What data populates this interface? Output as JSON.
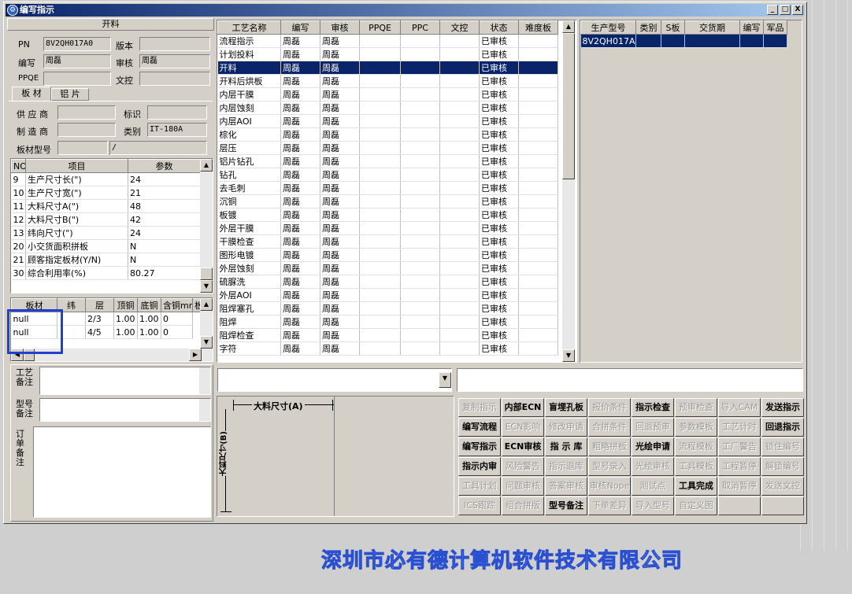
{
  "window": {
    "title": "编写指示",
    "min": "_",
    "max": "□",
    "close": "X"
  },
  "cut": {
    "header": "开料",
    "pn_label": "PN",
    "pn": "8V2QH017A0",
    "version_label": "版本",
    "version": "",
    "writer_label": "编写",
    "writer": "周磊",
    "audit_label": "审核",
    "audit": "周磊",
    "ppqe_label": "PPQE",
    "ppqe": "",
    "control_label": "文控",
    "control": ""
  },
  "tabs": [
    "板 材",
    "铝 片"
  ],
  "board": {
    "supplier_label": "供 应 商",
    "supplier": "",
    "mark_label": "标识",
    "mark": "",
    "maker_label": "制 造 商",
    "maker": "",
    "category_label": "类别",
    "category": "IT-180A",
    "model_label": "板材型号",
    "model": "",
    "model2": "/"
  },
  "params": {
    "headers": [
      "NO",
      "项目",
      "参数"
    ],
    "rows": [
      [
        "9",
        "生产尺寸长(\")",
        "24"
      ],
      [
        "10",
        "生产尺寸宽(\")",
        "21"
      ],
      [
        "11",
        "大料尺寸A(\")",
        "48"
      ],
      [
        "12",
        "大料尺寸B(\")",
        "42"
      ],
      [
        "13",
        "纬向尺寸(\")",
        "24"
      ],
      [
        "20",
        "小交货面积拼板",
        "N"
      ],
      [
        "21",
        "顾客指定板材(Y/N)",
        "N"
      ],
      [
        "30",
        "综合利用率(%)",
        "80.27"
      ]
    ]
  },
  "mat": {
    "headers": [
      "板材",
      "纬",
      "层",
      "顶铜",
      "底铜",
      "含铜mm",
      "板"
    ],
    "rows": [
      [
        "null",
        "",
        "2/3",
        "1.00",
        "1.00",
        "0"
      ],
      [
        "null",
        "",
        "4/5",
        "1.00",
        "1.00",
        "0"
      ]
    ]
  },
  "notes": {
    "process_label": "工艺备注",
    "type_label": "型号备注",
    "order_label": "订单备注"
  },
  "process": {
    "headers": [
      "工艺名称",
      "编写",
      "审核",
      "PPQE",
      "PPC",
      "文控",
      "状态",
      "难度板"
    ],
    "rows": [
      [
        "流程指示",
        "周磊",
        "周磊",
        "",
        "",
        "",
        "已审核",
        ""
      ],
      [
        "计划投料",
        "周磊",
        "周磊",
        "",
        "",
        "",
        "已审核",
        ""
      ],
      [
        "开料",
        "周磊",
        "周磊",
        "",
        "",
        "",
        "已审核",
        ""
      ],
      [
        "开料后烘板",
        "周磊",
        "周磊",
        "",
        "",
        "",
        "已审核",
        ""
      ],
      [
        "内层干膜",
        "周磊",
        "周磊",
        "",
        "",
        "",
        "已审核",
        ""
      ],
      [
        "内层蚀刻",
        "周磊",
        "周磊",
        "",
        "",
        "",
        "已审核",
        ""
      ],
      [
        "内层AOI",
        "周磊",
        "周磊",
        "",
        "",
        "",
        "已审核",
        ""
      ],
      [
        "棕化",
        "周磊",
        "周磊",
        "",
        "",
        "",
        "已审核",
        ""
      ],
      [
        "层压",
        "周磊",
        "周磊",
        "",
        "",
        "",
        "已审核",
        ""
      ],
      [
        "铝片钻孔",
        "周磊",
        "周磊",
        "",
        "",
        "",
        "已审核",
        ""
      ],
      [
        "钻孔",
        "周磊",
        "周磊",
        "",
        "",
        "",
        "已审核",
        ""
      ],
      [
        "去毛刺",
        "周磊",
        "周磊",
        "",
        "",
        "",
        "已审核",
        ""
      ],
      [
        "沉铜",
        "周磊",
        "周磊",
        "",
        "",
        "",
        "已审核",
        ""
      ],
      [
        "板镀",
        "周磊",
        "周磊",
        "",
        "",
        "",
        "已审核",
        ""
      ],
      [
        "外层干膜",
        "周磊",
        "周磊",
        "",
        "",
        "",
        "已审核",
        ""
      ],
      [
        "干膜检查",
        "周磊",
        "周磊",
        "",
        "",
        "",
        "已审核",
        ""
      ],
      [
        "图形电镀",
        "周磊",
        "周磊",
        "",
        "",
        "",
        "已审核",
        ""
      ],
      [
        "外层蚀刻",
        "周磊",
        "周磊",
        "",
        "",
        "",
        "已审核",
        ""
      ],
      [
        "硫脲洗",
        "周磊",
        "周磊",
        "",
        "",
        "",
        "已审核",
        ""
      ],
      [
        "外层AOI",
        "周磊",
        "周磊",
        "",
        "",
        "",
        "已审核",
        ""
      ],
      [
        "阻焊塞孔",
        "周磊",
        "周磊",
        "",
        "",
        "",
        "已审核",
        ""
      ],
      [
        "阻焊",
        "周磊",
        "周磊",
        "",
        "",
        "",
        "已审核",
        ""
      ],
      [
        "阻焊检查",
        "周磊",
        "周磊",
        "",
        "",
        "",
        "已审核",
        ""
      ],
      [
        "字符",
        "周磊",
        "周磊",
        "",
        "",
        "",
        "已审核",
        ""
      ]
    ],
    "selected": 2
  },
  "models": {
    "headers": [
      "生产型号",
      "类别",
      "S板",
      "交货期",
      "编写",
      "军品"
    ],
    "rows": [
      [
        "8V2QH017A0",
        "",
        "",
        "",
        "",
        ""
      ]
    ]
  },
  "diagram": {
    "a_label": "大料尺寸(A)",
    "b_label": "大料尺寸(B)"
  },
  "buttons": [
    [
      {
        "t": "复制指示",
        "en": false
      },
      {
        "t": "内部ECN",
        "en": true
      },
      {
        "t": "盲埋孔板",
        "en": true
      },
      {
        "t": "报价条件",
        "en": false
      },
      {
        "t": "指示检查",
        "en": true
      },
      {
        "t": "预审检查",
        "en": false
      },
      {
        "t": "导入CAM",
        "en": false
      },
      {
        "t": "发送指示",
        "en": true
      }
    ],
    [
      {
        "t": "编写流程",
        "en": true
      },
      {
        "t": "ECN影响",
        "en": false
      },
      {
        "t": "修改申请",
        "en": false
      },
      {
        "t": "合拼条件",
        "en": false
      },
      {
        "t": "回退预审",
        "en": false
      },
      {
        "t": "参数模板",
        "en": false
      },
      {
        "t": "工艺计时",
        "en": false
      },
      {
        "t": "回退指示",
        "en": true
      }
    ],
    [
      {
        "t": "编写指示",
        "en": true
      },
      {
        "t": "ECN审核",
        "en": true
      },
      {
        "t": "指 示 库",
        "en": true
      },
      {
        "t": "粗略拼板",
        "en": false
      },
      {
        "t": "光绘申请",
        "en": true
      },
      {
        "t": "流程模板",
        "en": false
      },
      {
        "t": "工厂警告",
        "en": false
      },
      {
        "t": "锁住编号",
        "en": false
      }
    ],
    [
      {
        "t": "指示内审",
        "en": true
      },
      {
        "t": "风险警告",
        "en": false
      },
      {
        "t": "指示退库",
        "en": false
      },
      {
        "t": "型号录入",
        "en": false
      },
      {
        "t": "光绘审核",
        "en": false
      },
      {
        "t": "工具模板",
        "en": false
      },
      {
        "t": "工程暂停",
        "en": false
      },
      {
        "t": "解锁编号",
        "en": false
      }
    ],
    [
      {
        "t": "工具计划",
        "en": false
      },
      {
        "t": "问题审核",
        "en": false
      },
      {
        "t": "答案审核",
        "en": false
      },
      {
        "t": "审核Nope",
        "en": false
      },
      {
        "t": "测试点",
        "en": false
      },
      {
        "t": "工具完成",
        "en": true
      },
      {
        "t": "取消暂停",
        "en": false
      },
      {
        "t": "发送文控",
        "en": false
      }
    ],
    [
      {
        "t": "ICS跟踪",
        "en": false
      },
      {
        "t": "组合拼版",
        "en": false
      },
      {
        "t": "型号备注",
        "en": true
      },
      {
        "t": "下单差异",
        "en": false
      },
      {
        "t": "导入型号",
        "en": false
      },
      {
        "t": "自定义图",
        "en": false
      },
      {
        "t": "",
        "en": false
      },
      {
        "t": "",
        "en": false
      }
    ]
  ],
  "company": "深圳市必有德计算机软件技术有限公司"
}
